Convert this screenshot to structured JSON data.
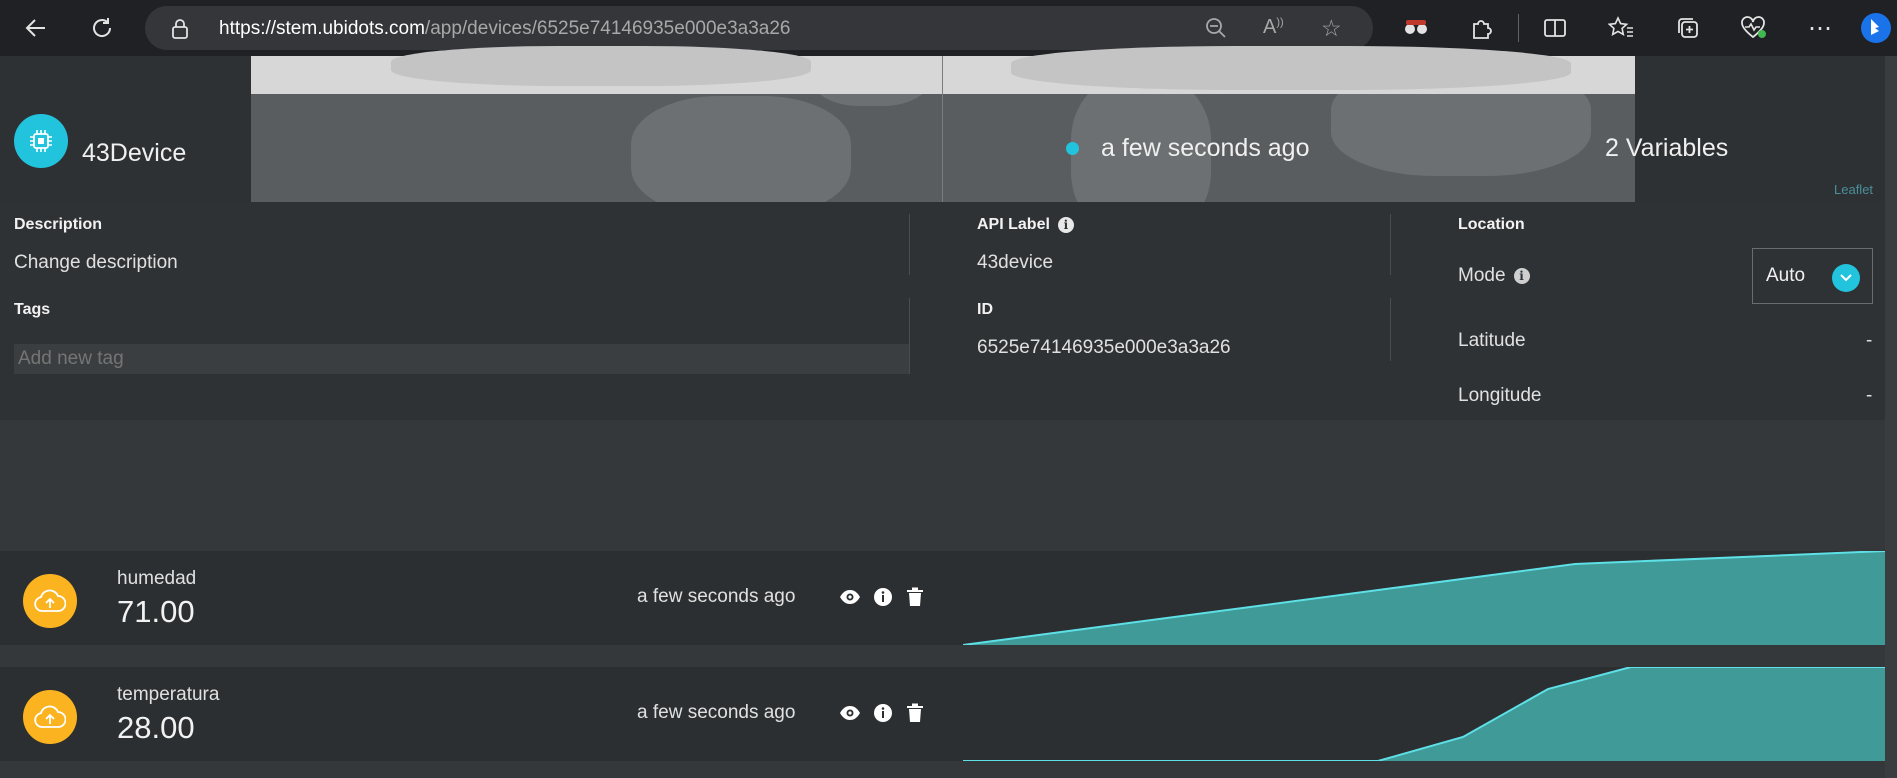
{
  "browser": {
    "url_host": "https://stem.ubidots.com",
    "url_path": "/app/devices/6525e74146935e000e3a3a26"
  },
  "header": {
    "device_name": "43Device",
    "last_activity": "a few seconds ago",
    "variables_count": "2 Variables",
    "map_attribution": "Leaflet"
  },
  "info": {
    "description_label": "Description",
    "description_value": "Change description",
    "tags_label": "Tags",
    "tags_placeholder": "Add new tag",
    "api_label_label": "API Label",
    "api_label_value": "43device",
    "id_label": "ID",
    "id_value": "6525e74146935e000e3a3a26",
    "location_label": "Location",
    "mode_label": "Mode",
    "mode_value": "Auto",
    "latitude_label": "Latitude",
    "latitude_value": "-",
    "longitude_label": "Longitude",
    "longitude_value": "-"
  },
  "variables": [
    {
      "name": "humedad",
      "value": "71.00",
      "time": "a few seconds ago"
    },
    {
      "name": "temperatura",
      "value": "28.00",
      "time": "a few seconds ago"
    }
  ],
  "colors": {
    "accent": "#22c3dc",
    "variable_icon": "#fbb320",
    "sparkline_fill": "#3f9a98",
    "sparkline_line": "#5ee0e6"
  }
}
